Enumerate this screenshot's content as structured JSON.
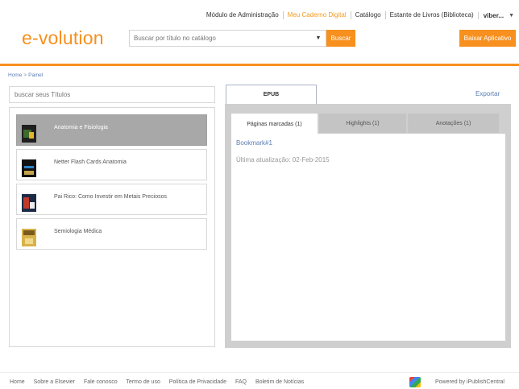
{
  "nav": {
    "items": [
      "Módulo de Administração",
      "Meu Caderno Digital",
      "Catálogo",
      "Estante de Livros (Biblioteca)"
    ],
    "user": "viber...",
    "accent": "#f39a1f"
  },
  "header": {
    "logo": "e-volution",
    "search_placeholder": "Buscar por título no catálogo",
    "search_button": "Buscar",
    "app_button": "Baixar Aplicativo",
    "brand_color": "#f7901e"
  },
  "breadcrumb": {
    "home": "Home",
    "separator": ">",
    "current": "Painel"
  },
  "library": {
    "search_placeholder": "buscar seus Títulos",
    "books": [
      {
        "title": "Anatomia e Fisiologia",
        "selected": true
      },
      {
        "title": "Netter Flash Cards Anatomia",
        "selected": false
      },
      {
        "title": "Pai Rico: Como Investir em Metais Preciosos",
        "selected": false
      },
      {
        "title": "Semiologia Médica",
        "selected": false
      }
    ]
  },
  "reader": {
    "format_tab": "EPUB",
    "export_label": "Exportar",
    "tabs": [
      {
        "label": "Páginas marcadas (1)",
        "active": true
      },
      {
        "label": "Highlights (1)",
        "active": false
      },
      {
        "label": "Anotações (1)",
        "active": false
      }
    ],
    "bookmark": "Bookmark#1",
    "last_update": "Última atualização: 02-Feb-2015"
  },
  "footer": {
    "links": [
      "Home",
      "Sobre a Elsevier",
      "Fale conosco",
      "Termo de uso",
      "Política de Privacidade",
      "FAQ",
      "Boletim de Notícias"
    ],
    "powered": "Powered by iPublishCentral"
  }
}
